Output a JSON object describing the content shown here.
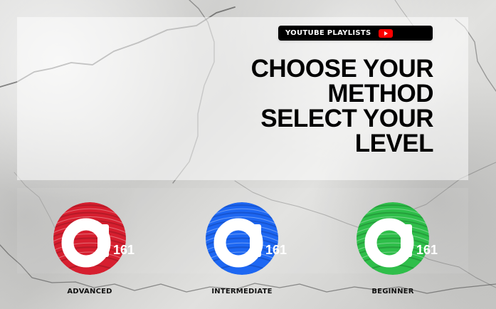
{
  "header": {
    "badge_label": "YOUTUBE PLAYLISTS",
    "badge_icon": "youtube-icon",
    "title_lines": [
      "CHOOSE YOUR",
      "METHOD",
      "SELECT YOUR",
      "LEVEL"
    ]
  },
  "levels": [
    {
      "label": "ADVANCED",
      "brand_text": "161",
      "color": "#d61f2f",
      "icon": "fingerprint-a-icon"
    },
    {
      "label": "INTERMEDIATE",
      "brand_text": "161",
      "color": "#1d67f2",
      "icon": "fingerprint-a-icon"
    },
    {
      "label": "BEGINNER",
      "brand_text": "161",
      "color": "#2fbe4a",
      "icon": "fingerprint-a-icon"
    }
  ],
  "theme": {
    "background_texture": "cracked-concrete",
    "panel_tint": "#ffffff",
    "badge_bg": "#000000",
    "youtube_red": "#ff0000",
    "text_dark": "#000000"
  }
}
